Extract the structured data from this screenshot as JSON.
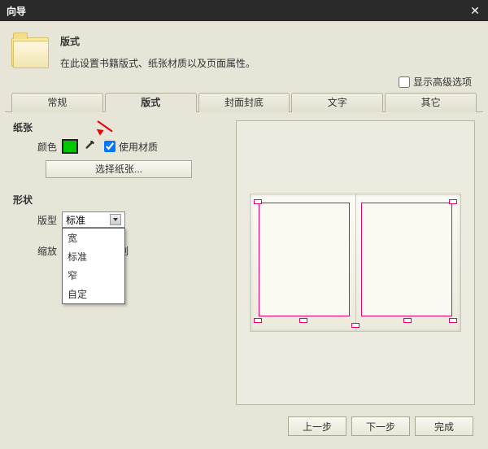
{
  "window": {
    "title": "向导"
  },
  "header": {
    "title": "版式",
    "description": "在此设置书籍版式、纸张材质以及页面属性。",
    "show_advanced": "显示高级选项"
  },
  "tabs": [
    "常规",
    "版式",
    "封面封底",
    "文字",
    "其它"
  ],
  "left": {
    "paper_section": "纸张",
    "color_label": "颜色",
    "color_value": "#00C800",
    "use_material": "使用材质",
    "choose_paper": "选择纸张...",
    "shape_section": "形状",
    "layout_label": "版型",
    "layout_value": "标准",
    "layout_options": [
      "宽",
      "标准",
      "窄",
      "自定"
    ],
    "scale_label": "缩放",
    "scale_value": "",
    "scale_ratio": "比例"
  },
  "footer": {
    "prev": "上一步",
    "next": "下一步",
    "finish": "完成"
  }
}
